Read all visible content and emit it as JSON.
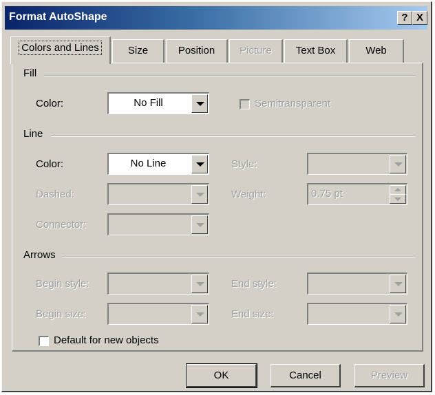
{
  "window": {
    "title": "Format AutoShape",
    "help_button": "?",
    "close_button": "X"
  },
  "tabs": [
    {
      "label": "Colors and Lines",
      "active": true,
      "enabled": true
    },
    {
      "label": "Size",
      "active": false,
      "enabled": true
    },
    {
      "label": "Position",
      "active": false,
      "enabled": true
    },
    {
      "label": "Picture",
      "active": false,
      "enabled": false
    },
    {
      "label": "Text Box",
      "active": false,
      "enabled": true
    },
    {
      "label": "Web",
      "active": false,
      "enabled": true
    }
  ],
  "fill": {
    "section_label": "Fill",
    "color_label": "Color:",
    "color_value": "No Fill",
    "semitransparent_label": "Semitransparent",
    "semitransparent_checked": false
  },
  "line": {
    "section_label": "Line",
    "color_label": "Color:",
    "color_value": "No Line",
    "style_label": "Style:",
    "dashed_label": "Dashed:",
    "weight_label": "Weight:",
    "weight_value": "0.75 pt",
    "connector_label": "Connector:"
  },
  "arrows": {
    "section_label": "Arrows",
    "begin_style_label": "Begin style:",
    "end_style_label": "End style:",
    "begin_size_label": "Begin size:",
    "end_size_label": "End size:"
  },
  "default_checkbox": {
    "label": "Default for new objects",
    "checked": false
  },
  "buttons": {
    "ok": "OK",
    "cancel": "Cancel",
    "preview": "Preview"
  },
  "colors": {
    "dialog_bg": "#d4d0c8",
    "title_start": "#0a246a",
    "title_end": "#a6caf0",
    "disabled_text": "#a0a0a0"
  }
}
